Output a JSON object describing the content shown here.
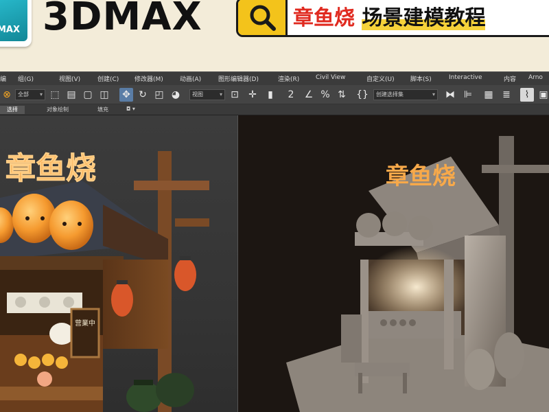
{
  "banner": {
    "logo_text": "MAX",
    "title": "3DMAX",
    "search_red": "章鱼烧",
    "search_black": "场景建模教程"
  },
  "menu": [
    "编",
    "组(G)",
    "视图(V)",
    "创建(C)",
    "修改器(M)",
    "动画(A)",
    "图形编辑器(D)",
    "渲染(R)",
    "Civil View",
    "自定义(U)",
    "脚本(S)",
    "Interactive",
    "内容",
    "Arno"
  ],
  "toolbar": {
    "filter_dropdown": "全部",
    "view_dropdown": "视图",
    "selection_set_dropdown": "创建选择集"
  },
  "subtabs": {
    "select": "选择",
    "object_paint": "对象绘制",
    "populate": "填充"
  },
  "scene": {
    "sign_left": "章鱼烧",
    "sign_right": "章鱼烧",
    "board_text": "营業中"
  },
  "colors": {
    "search_accent": "#f3c31b",
    "title_red": "#e02a20",
    "active_tool": "#5a7da6",
    "sign_orange": "#f7a94a"
  }
}
